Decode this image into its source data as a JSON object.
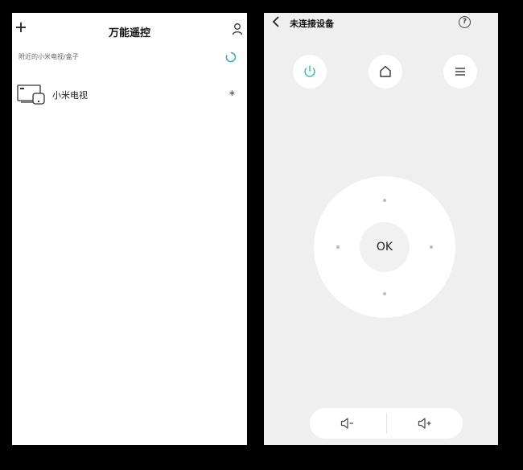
{
  "left_screen": {
    "header": {
      "title": "万能遥控",
      "add_icon": "plus-icon",
      "user_icon": "user-icon"
    },
    "nearby_label": "附近的小米电视/盒子",
    "refresh_icon": "refresh-spinner-icon",
    "devices": [
      {
        "name": "小米电视",
        "icon": "tv-icon",
        "status_icon": "bluetooth-icon",
        "status_glyph": "∗"
      }
    ]
  },
  "right_screen": {
    "header": {
      "title": "未连接设备",
      "back_icon": "back-chevron-icon",
      "help_glyph": "?"
    },
    "buttons": {
      "power": "power-icon",
      "home": "home-icon",
      "menu": "menu-icon"
    },
    "dpad": {
      "ok_label": "OK"
    },
    "volume": {
      "down": "volume-down-icon",
      "up": "volume-up-icon"
    },
    "colors": {
      "power_accent": "#3cc1b0",
      "spinner_accent": "#3aa9d8"
    }
  }
}
